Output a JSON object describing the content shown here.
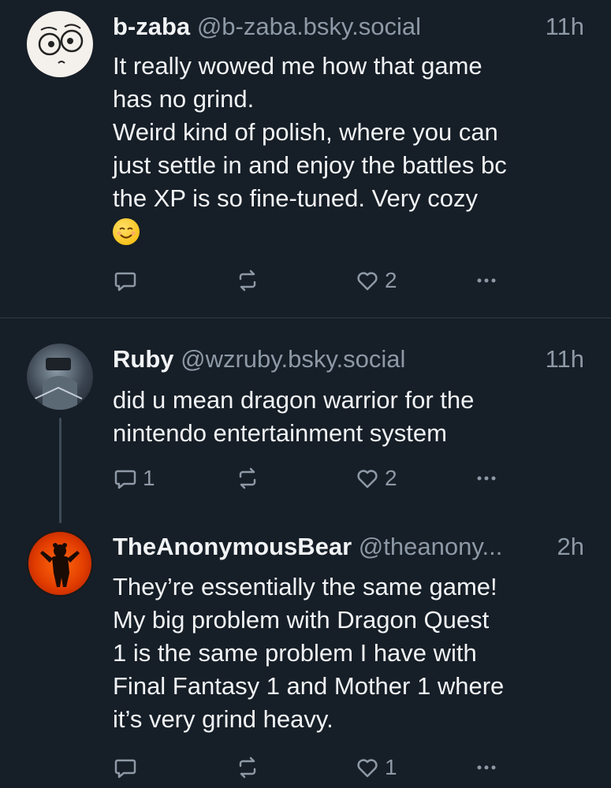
{
  "posts": [
    {
      "author": "b-zaba",
      "handle": "@b-zaba.bsky.social",
      "time": "11h",
      "lines": [
        "It really wowed me how that game",
        "has no grind.",
        "Weird kind of polish, where you can",
        "just settle in and enjoy the battles bc",
        "the XP is so fine-tuned. Very cozy"
      ],
      "emoji": "smiling-face-emoji",
      "replies": "",
      "reposts": "",
      "likes": "2"
    },
    {
      "author": "Ruby",
      "handle": "@wzruby.bsky.social",
      "time": "11h",
      "lines": [
        "did u mean dragon warrior for the",
        "nintendo entertainment system"
      ],
      "replies": "1",
      "reposts": "",
      "likes": "2"
    },
    {
      "author": "TheAnonymousBear",
      "handle": "@theanony...",
      "time": "2h",
      "lines": [
        "They’re essentially the same game!",
        "My big problem with Dragon Quest",
        "1 is the same problem I have with",
        "Final Fantasy 1 and Mother 1 where",
        "it’s very grind heavy."
      ],
      "replies": "",
      "reposts": "",
      "likes": "1"
    }
  ],
  "colors": {
    "background": "#161e27",
    "text": "#f1f3f5",
    "muted": "#8d99a6",
    "divider": "#2e3a47"
  }
}
